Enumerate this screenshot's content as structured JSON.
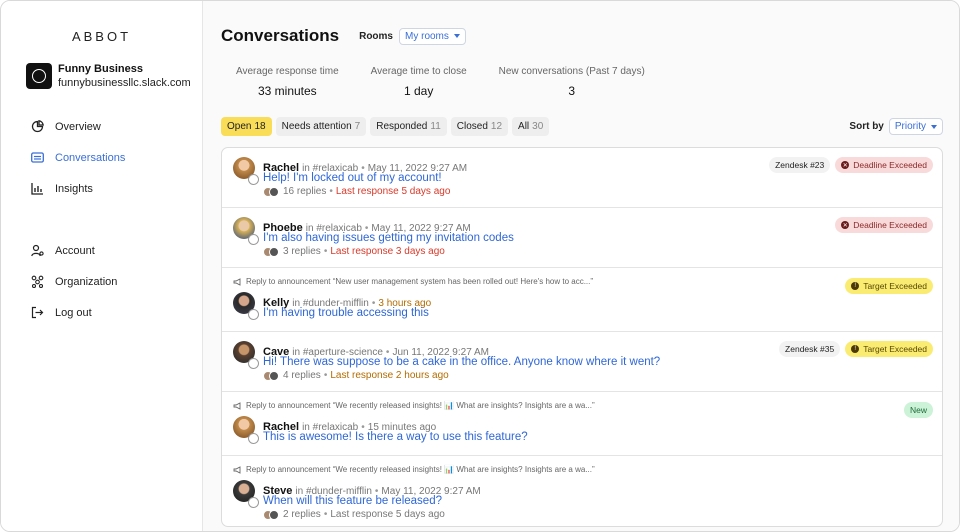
{
  "app": {
    "brand": "ABBOT"
  },
  "workspace": {
    "name": "Funny Business",
    "domain": "funnybusinessllc.slack.com"
  },
  "nav": {
    "overview": "Overview",
    "conversations": "Conversations",
    "insights": "Insights",
    "account": "Account",
    "organization": "Organization",
    "logout": "Log out"
  },
  "header": {
    "title": "Conversations",
    "rooms_label": "Rooms",
    "rooms_value": "My rooms"
  },
  "stats": [
    {
      "label": "Average response time",
      "value": "33 minutes"
    },
    {
      "label": "Average time to close",
      "value": "1 day"
    },
    {
      "label": "New conversations (Past 7 days)",
      "value": "3"
    }
  ],
  "filters": [
    {
      "label": "Open",
      "count": "18"
    },
    {
      "label": "Needs attention",
      "count": "7"
    },
    {
      "label": "Responded",
      "count": "11"
    },
    {
      "label": "Closed",
      "count": "12"
    },
    {
      "label": "All",
      "count": "30"
    }
  ],
  "sort": {
    "label": "Sort by",
    "value": "Priority"
  },
  "conversations": [
    {
      "reply_note": "",
      "author": "Rachel",
      "room": "#relaxicab",
      "time": "May 11, 2022 9:27 AM",
      "message": "Help! I'm locked out of my account!",
      "replies": "16 replies",
      "last": "Last response 5 days ago",
      "zendesk": "Zendesk #23",
      "status": "Deadline Exceeded"
    },
    {
      "reply_note": "",
      "author": "Phoebe",
      "room": "#relaxicab",
      "time": "May 11, 2022 9:27 AM",
      "message": "I'm also having issues getting my invitation codes",
      "replies": "3 replies",
      "last": "Last response 3 days ago",
      "zendesk": "",
      "status": "Deadline Exceeded"
    },
    {
      "reply_note": "Reply to announcement “New user management system has been rolled out! Here's how to acc...”",
      "author": "Kelly",
      "room": "#dunder-mifflin",
      "time": "3 hours ago",
      "message": "I'm having trouble accessing this",
      "replies": "",
      "last": "",
      "zendesk": "",
      "status": "Target Exceeded"
    },
    {
      "reply_note": "",
      "author": "Cave",
      "room": "#aperture-science",
      "time": "Jun 11, 2022 9:27 AM",
      "message": "Hi! There was suppose to be a cake in the office. Anyone know where it went?",
      "replies": "4 replies",
      "last": "Last response 2 hours ago",
      "zendesk": "Zendesk #35",
      "status": "Target Exceeded"
    },
    {
      "reply_note": "Reply to announcement “We recently released insights! 📊 What are insights? Insights are a wa...”",
      "author": "Rachel",
      "room": "#relaxicab",
      "time": "15 minutes ago",
      "message": "This is awesome! Is there a way to use this feature?",
      "replies": "",
      "last": "",
      "zendesk": "",
      "status": "New"
    },
    {
      "reply_note": "Reply to announcement “We recently released insights! 📊 What are insights? Insights are a wa...”",
      "author": "Steve",
      "room": "#dunder-mifflin",
      "time": "May 11, 2022 9:27 AM",
      "message": "When will this feature be released?",
      "replies": "2 replies",
      "last": "Last response 5 days ago",
      "zendesk": "",
      "status": ""
    }
  ],
  "words": {
    "in": "in"
  },
  "icons": {
    "overview": "pie-chart-icon",
    "conversations": "inbox-icon",
    "insights": "bar-chart-icon",
    "account": "user-gear-icon",
    "organization": "group-icon",
    "logout": "logout-icon",
    "reply": "megaphone-icon"
  },
  "colors": {
    "accent": "#3a6fd8",
    "open_chip": "#f9dd58",
    "deadline": "#f9dada",
    "target": "#faec73",
    "new": "#ccf2d8"
  }
}
